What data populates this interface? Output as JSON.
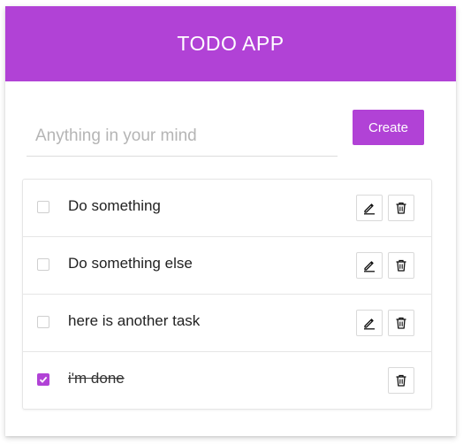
{
  "header": {
    "title": "TODO APP"
  },
  "form": {
    "placeholder": "Anything in your mind",
    "value": "",
    "create_label": "Create"
  },
  "todos": [
    {
      "label": "Do something",
      "done": false
    },
    {
      "label": "Do something else",
      "done": false
    },
    {
      "label": "here is another task",
      "done": false
    },
    {
      "label": "i'm done",
      "done": true
    }
  ],
  "icons": {
    "edit": "pencil-icon",
    "delete": "trash-icon",
    "check": "checkmark-icon"
  },
  "colors": {
    "accent": "#b142d6"
  }
}
